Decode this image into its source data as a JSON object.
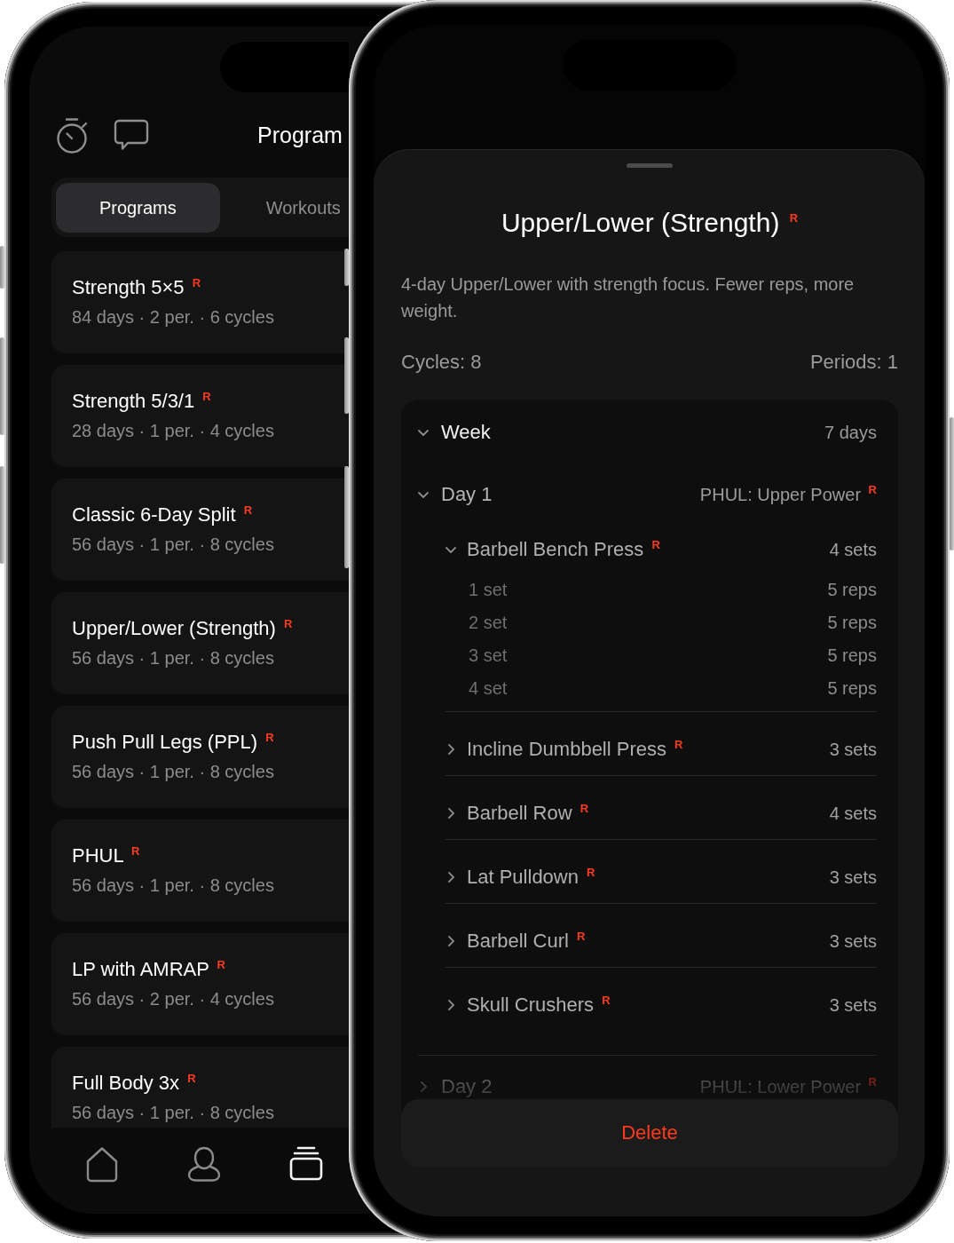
{
  "programs_screen": {
    "title": "Program",
    "segments": [
      {
        "label": "Programs",
        "selected": true
      },
      {
        "label": "Workouts",
        "selected": false
      }
    ],
    "programs": [
      {
        "title": "Strength 5×5 $^{R}$",
        "summary": "84 days · 2 per. · 6 cycles"
      },
      {
        "title": "Strength 5/3/1 $^{R}$",
        "summary": "28 days · 1 per. · 4 cycles"
      },
      {
        "title": "Classic 6-Day Split $^{R}$",
        "summary": "56 days · 1 per. · 8 cycles"
      },
      {
        "title": "Upper/Lower (Strength) $^{R}$",
        "summary": "56 days · 1 per. · 8 cycles"
      },
      {
        "title": "Push Pull Legs (PPL) $^{R}$",
        "summary": "56 days · 1 per. · 8 cycles"
      },
      {
        "title": "PHUL $^{R}$",
        "summary": "56 days · 1 per. · 8 cycles"
      },
      {
        "title": "LP with AMRAP $^{R}$",
        "summary": "56 days · 2 per. · 4 cycles"
      },
      {
        "title": "Full Body 3x $^{R}$",
        "summary": "56 days · 1 per. · 8 cycles"
      }
    ],
    "tab_bar": [
      {
        "kind": "home",
        "selected": false
      },
      {
        "kind": "profile",
        "selected": false
      },
      {
        "kind": "programs",
        "selected": true
      }
    ]
  },
  "detail_sheet": {
    "title": "Upper/Lower (Strength) $^{R}$",
    "description": "4-day Upper/Lower with strength focus. Fewer reps, more weight.",
    "cycles": "Cycles: 8",
    "periods": "Periods: 1",
    "tree": [
      {
        "kind": "group",
        "label": "Week",
        "detail": "7 days",
        "expanded": true,
        "children": [
          {
            "kind": "day",
            "label": "Day 1",
            "detail": "PHUL: Upper Power $^{R}$",
            "expanded": true,
            "children": [
              {
                "kind": "exercise",
                "label": "Barbell Bench Press $^{R}$",
                "detail": "4 sets",
                "expanded": true,
                "children": [
                  {
                    "kind": "set",
                    "label": "1 set",
                    "detail": "5 reps"
                  },
                  {
                    "kind": "set",
                    "label": "2 set",
                    "detail": "5 reps"
                  },
                  {
                    "kind": "set",
                    "label": "3 set",
                    "detail": "5 reps"
                  },
                  {
                    "kind": "set",
                    "label": "4 set",
                    "detail": "5 reps"
                  }
                ]
              },
              {
                "kind": "exercise",
                "label": "Incline Dumbbell Press $^{R}$",
                "detail": "3 sets",
                "expanded": false
              },
              {
                "kind": "exercise",
                "label": "Barbell Row $^{R}$",
                "detail": "4 sets",
                "expanded": false
              },
              {
                "kind": "exercise",
                "label": "Lat Pulldown $^{R}$",
                "detail": "3 sets",
                "expanded": false
              },
              {
                "kind": "exercise",
                "label": "Barbell Curl $^{R}$",
                "detail": "3 sets",
                "expanded": false
              },
              {
                "kind": "exercise",
                "label": "Skull Crushers $^{R}$",
                "detail": "3 sets",
                "expanded": false
              }
            ]
          },
          {
            "kind": "day",
            "label": "Day 2",
            "detail": "PHUL: Lower Power $^{R}$",
            "expanded": false
          }
        ]
      }
    ],
    "delete_button": "Delete"
  }
}
